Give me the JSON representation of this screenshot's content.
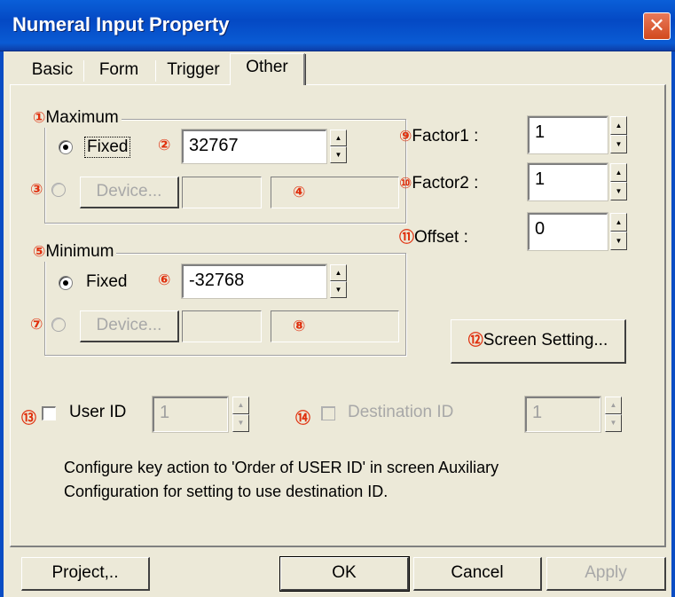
{
  "window": {
    "title": "Numeral Input Property",
    "close_glyph": "✕"
  },
  "tabs": [
    {
      "label": "Basic"
    },
    {
      "label": "Form"
    },
    {
      "label": "Trigger"
    },
    {
      "label": "Other"
    }
  ],
  "active_tab": "Other",
  "maximum": {
    "badge": "①",
    "legend": "Maximum",
    "fixed_label": "Fixed",
    "fixed_selected": true,
    "value_badge": "②",
    "value": "32767",
    "device_badge": "③",
    "device_button": "Device...",
    "device_value_badge": "④"
  },
  "minimum": {
    "badge": "⑤",
    "legend": "Minimum",
    "fixed_label": "Fixed",
    "fixed_selected": true,
    "value_badge": "⑥",
    "value": "-32768",
    "device_badge": "⑦",
    "device_button": "Device...",
    "device_value_badge": "⑧"
  },
  "factor1": {
    "badge": "⑨",
    "label": "Factor1 :",
    "value": "1"
  },
  "factor2": {
    "badge": "⑩",
    "label": "Factor2 :",
    "value": "1"
  },
  "offset": {
    "badge": "⑪",
    "label": "Offset :",
    "value": "0"
  },
  "screen_setting": {
    "badge": "⑫",
    "label": "Screen Setting..."
  },
  "user_id": {
    "badge": "⑬",
    "label": "User ID",
    "checked": false,
    "value": "1"
  },
  "destination_id": {
    "badge": "⑭",
    "label": "Destination ID",
    "checked": false,
    "value": "1"
  },
  "note": {
    "line1": "Configure key action to 'Order of USER ID' in screen Auxiliary",
    "line2": "Configuration for setting to use destination ID."
  },
  "footer": {
    "project": "Project,..",
    "ok": "OK",
    "cancel": "Cancel",
    "apply": "Apply"
  },
  "colors": {
    "title_bar": "#0A5FD8",
    "dialog_bg": "#ECE9D8",
    "badge": "#E0300E",
    "close": "#D24A1E"
  }
}
